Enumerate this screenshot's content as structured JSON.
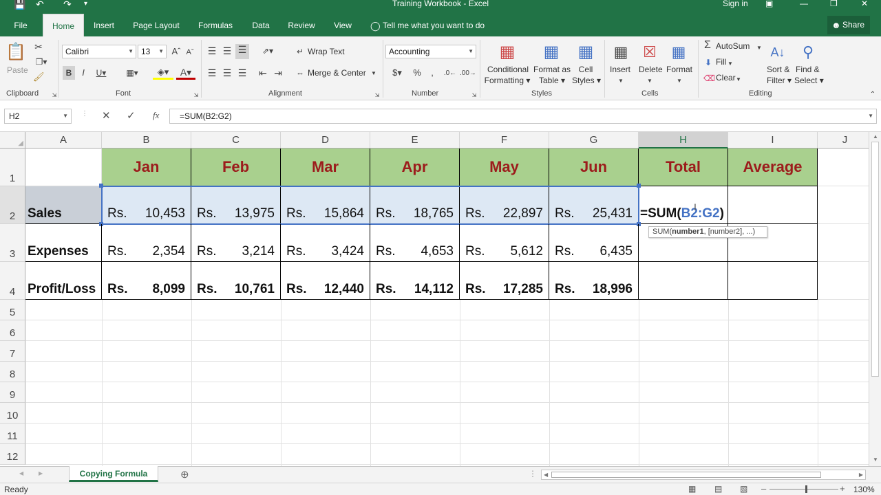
{
  "window": {
    "title": "Training Workbook - Excel",
    "sign_in": "Sign in"
  },
  "tabs": [
    "File",
    "Home",
    "Insert",
    "Page Layout",
    "Formulas",
    "Data",
    "Review",
    "View"
  ],
  "tell_me": "Tell me what you want to do",
  "share": "Share",
  "ribbon": {
    "paste": "Paste",
    "font_name": "Calibri",
    "font_size": "13",
    "wrap_text": "Wrap Text",
    "merge_center": "Merge & Center",
    "number_format": "Accounting",
    "conditional_formatting": [
      "Conditional",
      "Formatting"
    ],
    "format_as_table": [
      "Format as",
      "Table"
    ],
    "cell_styles": [
      "Cell",
      "Styles"
    ],
    "insert": "Insert",
    "delete": "Delete",
    "format": "Format",
    "autosum": "AutoSum",
    "fill": "Fill",
    "clear": "Clear",
    "sort_filter": [
      "Sort &",
      "Filter"
    ],
    "find_select": [
      "Find &",
      "Select"
    ],
    "groups": {
      "clipboard": "Clipboard",
      "font": "Font",
      "alignment": "Alignment",
      "number": "Number",
      "styles": "Styles",
      "cells": "Cells",
      "editing": "Editing"
    }
  },
  "formula_bar": {
    "name_box": "H2",
    "formula": "=SUM(B2:G2)",
    "fx": "fx"
  },
  "grid": {
    "columns": [
      "A",
      "B",
      "C",
      "D",
      "E",
      "F",
      "G",
      "H",
      "I",
      "J"
    ],
    "rows": [
      "1",
      "2",
      "3",
      "4",
      "5",
      "6",
      "7",
      "8",
      "9",
      "10",
      "11",
      "12"
    ],
    "headers": [
      "Jan",
      "Feb",
      "Mar",
      "Apr",
      "May",
      "Jun",
      "Total",
      "Average"
    ],
    "row_labels": [
      "Sales",
      "Expenses",
      "Profit/Loss"
    ],
    "currency": "Rs.",
    "sales": [
      "10,453",
      "13,975",
      "15,864",
      "18,765",
      "22,897",
      "25,431"
    ],
    "expenses": [
      "2,354",
      "3,214",
      "3,424",
      "4,653",
      "5,612",
      "6,435"
    ],
    "profit": [
      "8,099",
      "10,761",
      "12,440",
      "14,112",
      "17,285",
      "18,996"
    ],
    "editing_cell": {
      "prefix": "=SUM(",
      "ref": "B2:G2",
      "suffix": ")"
    },
    "tooltip": {
      "fn": "SUM(",
      "arg1": "number1",
      "rest": ", [number2], ...)"
    }
  },
  "sheet_tab": "Copying Formula",
  "status": {
    "ready": "Ready",
    "zoom": "130%"
  }
}
